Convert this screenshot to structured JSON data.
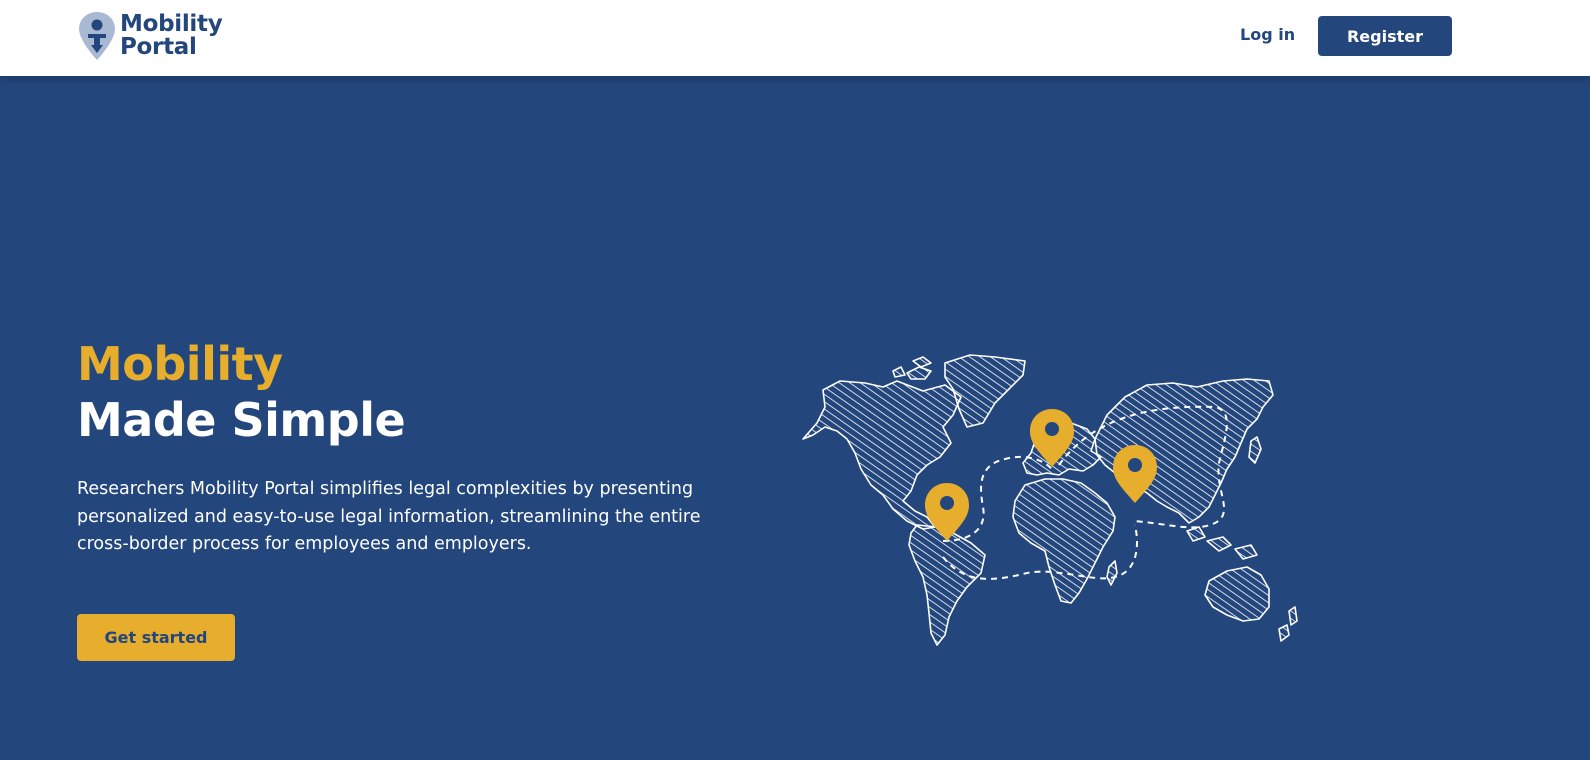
{
  "header": {
    "logo_line1": "Mobility",
    "logo_line2": "Portal",
    "login_label": "Log in",
    "register_label": "Register"
  },
  "hero": {
    "title_accent": "Mobility",
    "title_main": "Made Simple",
    "description": "Researchers Mobility Portal simplifies legal complexities by presenting personalized and easy-to-use legal information, streamlining the entire cross-border process for employees and employers.",
    "cta_label": "Get started"
  },
  "colors": {
    "primary": "#23467d",
    "accent": "#e6ae2c",
    "background": "#ffffff"
  },
  "icons": {
    "logo": "person-pin-icon",
    "map": "world-map-illustration",
    "pins": "location-pin-icon"
  }
}
